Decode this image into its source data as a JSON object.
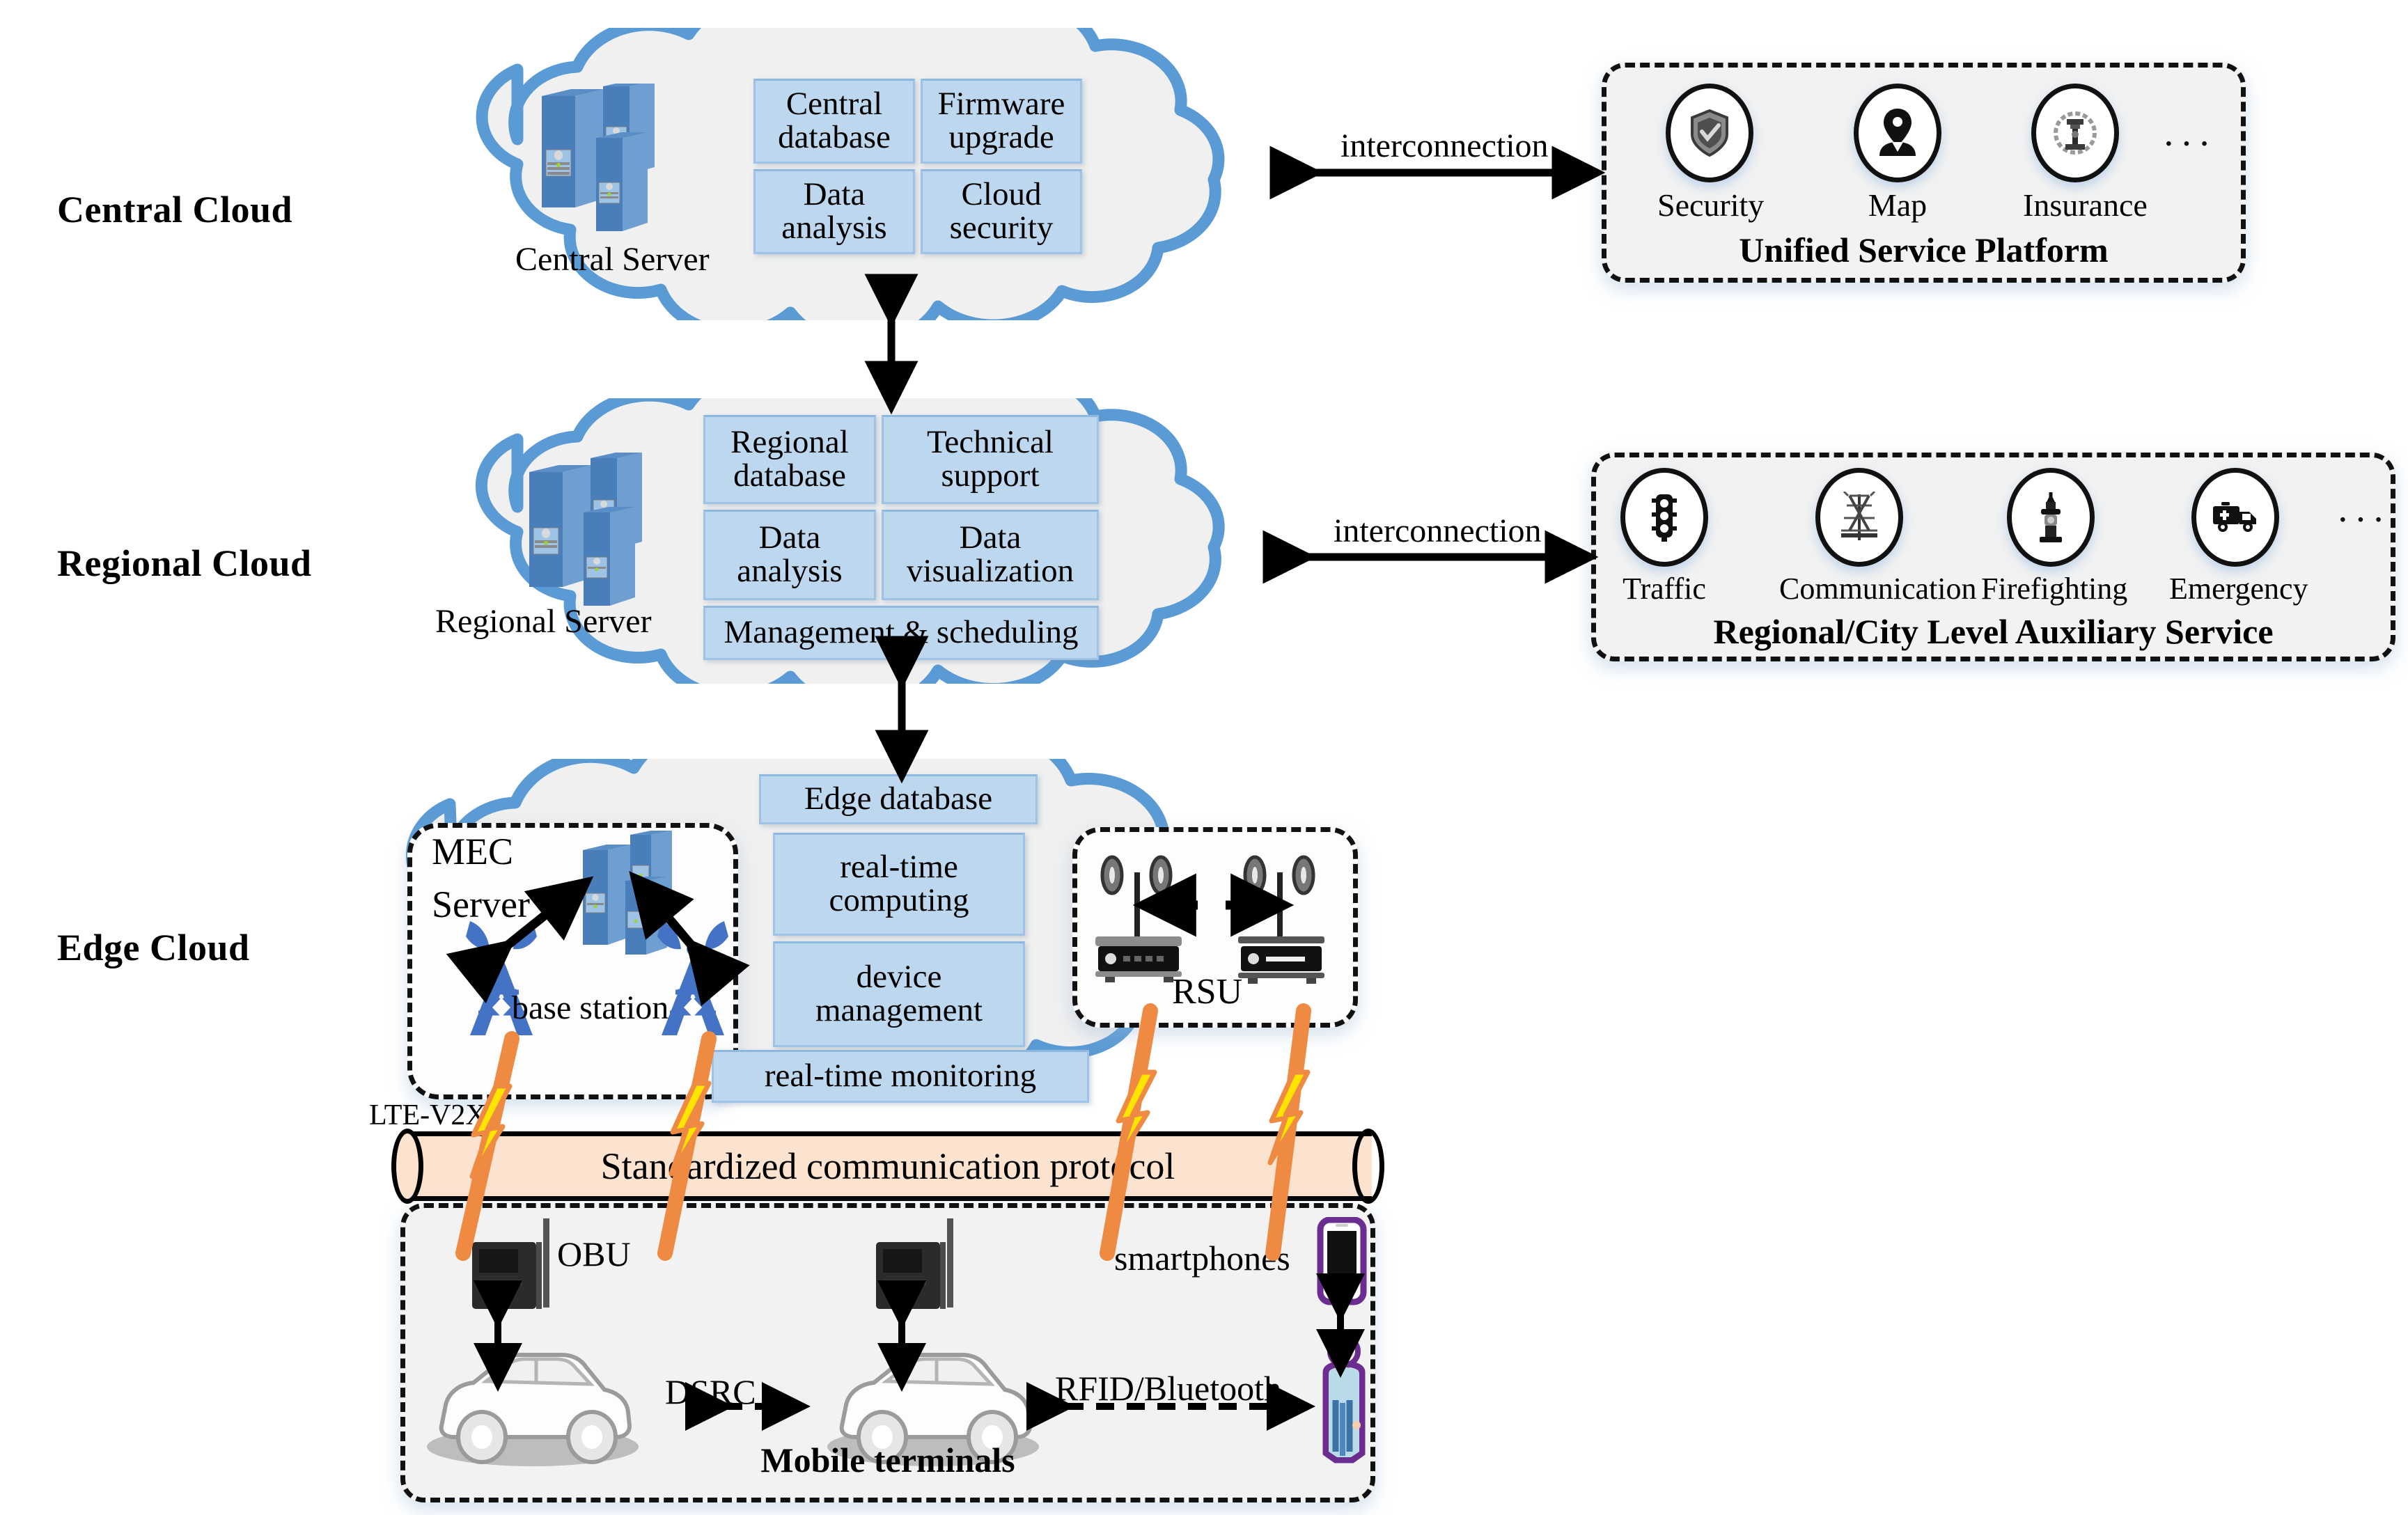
{
  "tiers": [
    {
      "label": "Central Cloud"
    },
    {
      "label": "Regional Cloud"
    },
    {
      "label": "Edge Cloud"
    }
  ],
  "central_cloud": {
    "server_label": "Central Server",
    "boxes": [
      {
        "label": "Central database"
      },
      {
        "label": "Firmware upgrade"
      },
      {
        "label": "Data analysis"
      },
      {
        "label": "Cloud security"
      }
    ]
  },
  "regional_cloud": {
    "server_label": "Regional Server",
    "boxes": [
      {
        "label": "Regional database"
      },
      {
        "label": "Technical support"
      },
      {
        "label": "Data analysis"
      },
      {
        "label": "Data visualization"
      },
      {
        "label": "Management & scheduling"
      }
    ]
  },
  "edge_cloud": {
    "mec_label_line1": "MEC",
    "mec_label_line2": "Server",
    "base_station_label": "base station",
    "rsu_label": "RSU",
    "boxes": [
      {
        "label": "Edge database"
      },
      {
        "label": "real-time computing"
      },
      {
        "label": "device management"
      },
      {
        "label": "real-time monitoring"
      }
    ]
  },
  "unified_service_platform": {
    "title": "Unified Service Platform",
    "items": [
      {
        "label": "Security",
        "icon": "shield-icon"
      },
      {
        "label": "Map",
        "icon": "map-pin-person-icon"
      },
      {
        "label": "Insurance",
        "icon": "insurance-emblem-icon"
      }
    ],
    "ellipsis": "···"
  },
  "auxiliary_service": {
    "title": "Regional/City Level Auxiliary Service",
    "items": [
      {
        "label": "Traffic",
        "icon": "traffic-light-icon"
      },
      {
        "label": "Communication",
        "icon": "comm-tower-icon"
      },
      {
        "label": "Firefighting",
        "icon": "fire-hydrant-icon"
      },
      {
        "label": "Emergency",
        "icon": "ambulance-icon"
      }
    ],
    "ellipsis": "···"
  },
  "connections": {
    "interconnection_top": "interconnection",
    "interconnection_mid": "interconnection",
    "lte_v2x": "LTE-V2X",
    "protocol_bar": "Standardized communication protocol",
    "dsrc": "DSRC",
    "rfid_bluetooth": "RFID/Bluetooth"
  },
  "mobile_terminals": {
    "title": "Mobile terminals",
    "obu_label": "OBU",
    "smartphones_label": "smartphones"
  },
  "colors": {
    "cloud_stroke": "#5b9bd5",
    "cloud_fill": "#f0f0f0",
    "box_fill": "#bdd7ee",
    "box_stroke": "#9ec3e6",
    "server_blue": "#4a7ebb",
    "protocol_fill": "#fce3d0",
    "bolt_orange": "#ef8a43",
    "bolt_yellow": "#ffe400",
    "panel_fill": "#f2f2f2"
  }
}
